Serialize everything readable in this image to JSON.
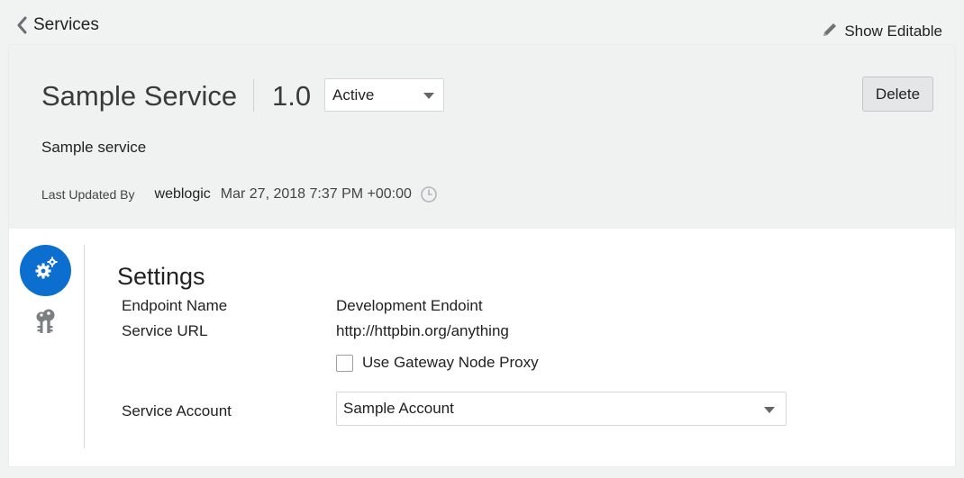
{
  "nav": {
    "back_label": "Services",
    "show_editable_label": "Show Editable"
  },
  "service": {
    "name": "Sample Service",
    "version": "1.0",
    "status": "Active",
    "delete_label": "Delete",
    "description": "Sample service",
    "last_updated_label": "Last Updated By",
    "last_updated_user": "weblogic",
    "last_updated_time": "Mar 27, 2018 7:37 PM +00:00"
  },
  "side_nav": {
    "items": [
      {
        "icon": "gears-icon",
        "active": true
      },
      {
        "icon": "keys-icon",
        "active": false
      }
    ]
  },
  "settings": {
    "title": "Settings",
    "endpoint_name_label": "Endpoint Name",
    "endpoint_name_value": "Development Endoint",
    "service_url_label": "Service URL",
    "service_url_value": "http://httpbin.org/anything",
    "use_proxy_label": "Use Gateway Node Proxy",
    "use_proxy_checked": false,
    "service_account_label": "Service Account",
    "service_account_value": "Sample Account"
  },
  "colors": {
    "accent": "#0c6fd0",
    "header_bg": "#f0f1f1",
    "page_bg": "#f1f2f2"
  }
}
